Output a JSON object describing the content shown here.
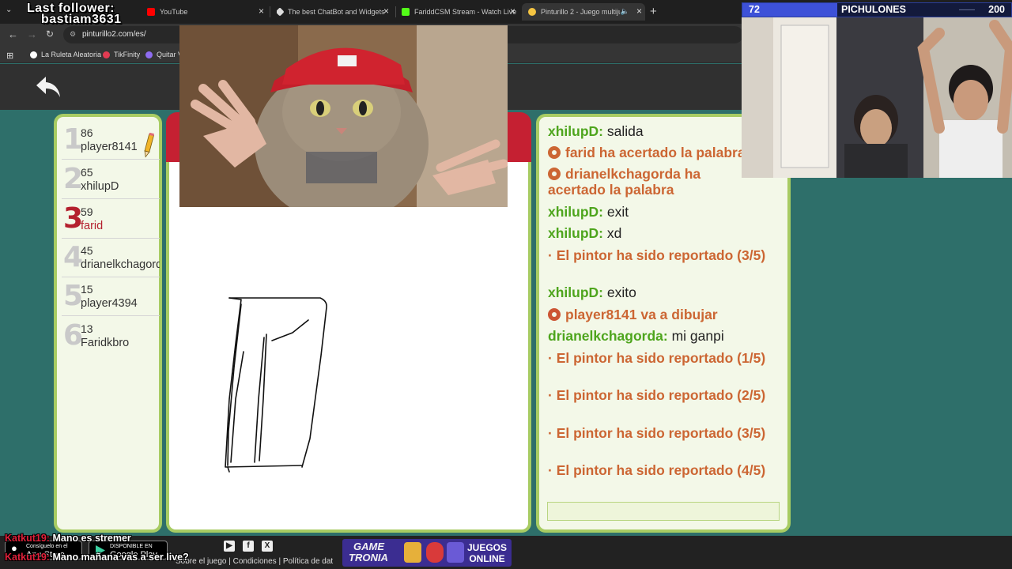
{
  "browser": {
    "tabs": [
      {
        "label": "YouTube",
        "favicon_color": "#ff0000"
      },
      {
        "label": "The best ChatBot and Widgets",
        "favicon_color": "#dddddd"
      },
      {
        "label": "FariddCSM Stream - Watch Live",
        "favicon_color": "#53fc18"
      },
      {
        "label": "Pinturillo 2 - Juego multijug",
        "favicon_color": "#f5c542"
      }
    ],
    "url": "pinturillo2.com/es/",
    "bookmarks": [
      {
        "label": "La Ruleta Aleatoria",
        "color": "#ffffff"
      },
      {
        "label": "TikFinity",
        "color": "#e23b52"
      },
      {
        "label": "Quitar V",
        "color": "#8e6cf0"
      }
    ]
  },
  "players": [
    {
      "rank": "1",
      "score": "86",
      "name": "player8141",
      "drawing": true
    },
    {
      "rank": "2",
      "score": "65",
      "name": "xhilupD",
      "drawing": false
    },
    {
      "rank": "3",
      "score": "59",
      "name": "farid",
      "drawing": false,
      "highlight": true
    },
    {
      "rank": "4",
      "score": "45",
      "name": "drianelkchagorda",
      "drawing": false
    },
    {
      "rank": "5",
      "score": "15",
      "name": "player4394",
      "drawing": false
    },
    {
      "rank": "6",
      "score": "13",
      "name": "Faridkbro",
      "drawing": false
    }
  ],
  "chat": {
    "messages": [
      {
        "type": "user",
        "user": "xhilupD:",
        "text": "salida"
      },
      {
        "type": "system",
        "text": "farid ha acertado la palabra"
      },
      {
        "type": "system",
        "text": "drianelkchagorda ha acertado la palabra"
      },
      {
        "type": "user",
        "user": "xhilupD:",
        "text": "exit"
      },
      {
        "type": "user",
        "user": "xhilupD:",
        "text": "xd"
      },
      {
        "type": "report",
        "text": "· El pintor ha sido reportado (3/5)"
      },
      {
        "type": "user",
        "user": "xhilupD:",
        "text": "exito"
      },
      {
        "type": "system",
        "text": "player8141 va a dibujar"
      },
      {
        "type": "user",
        "user": "drianelkchagorda:",
        "text": "mi ganpi"
      },
      {
        "type": "report",
        "text": "· El pintor ha sido reportado (1/5)"
      },
      {
        "type": "report",
        "text": "· El pintor ha sido reportado (2/5)"
      },
      {
        "type": "report",
        "text": "· El pintor ha sido reportado (3/5)"
      },
      {
        "type": "report",
        "text": "· El pintor ha sido reportado (4/5)"
      }
    ],
    "input_value": ""
  },
  "footer": {
    "links": "Sobre el juego | Condiciones | Política de dat",
    "app_store": {
      "line1": "Consíguelo en el",
      "line2": "App Store"
    },
    "google_play": {
      "line1": "DISPONIBLE EN",
      "line2": "Google Play"
    },
    "gametronia": {
      "name_line1": "GAME",
      "name_line2": "TRONIA",
      "juegos_line1": "JUEGOS",
      "juegos_line2": "ONLINE"
    }
  },
  "overlay": {
    "follower_line1": "Last follower:",
    "follower_line2": "bastiam3631",
    "top_number": "72",
    "team_name": "PICHULONES",
    "team_dash": "——",
    "team_points": "200",
    "stream_chat": [
      {
        "user": "Katkut19:",
        "text": "Mano es stremer"
      },
      {
        "user": "Katkut19:",
        "text": "Mano mañana vas a ser live?"
      }
    ]
  }
}
